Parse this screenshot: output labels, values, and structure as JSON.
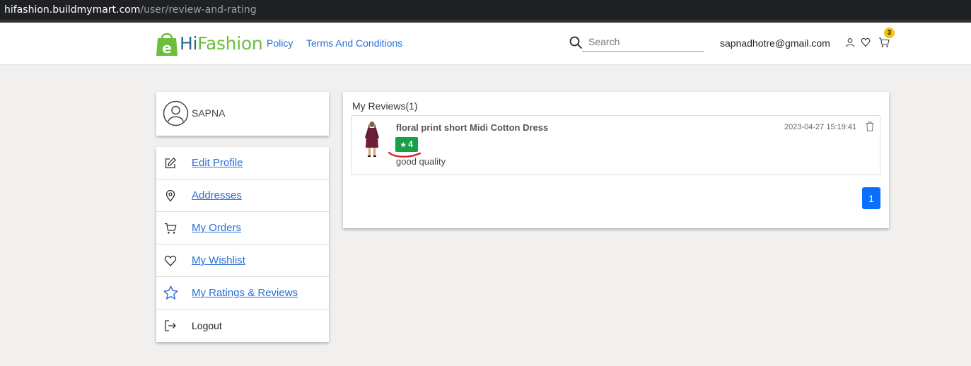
{
  "browser": {
    "url_domain": "hifashion.buildmymart.com",
    "url_path": "/user/review-and-rating"
  },
  "header": {
    "logo_hi": "Hi",
    "logo_fashion": "Fashion",
    "logo_letter": "e",
    "nav": [
      {
        "label": "Policy"
      },
      {
        "label": "Terms And Conditions"
      }
    ],
    "search": {
      "placeholder": "Search",
      "value": ""
    },
    "email": "sapnadhotre@gmail.com",
    "cart_count": "3",
    "icons": [
      "user-icon",
      "heart-icon",
      "cart-icon"
    ]
  },
  "sidebar": {
    "username": "SAPNA",
    "items": [
      {
        "label": "Edit Profile",
        "icon": "edit-icon"
      },
      {
        "label": "Addresses",
        "icon": "location-pin-icon"
      },
      {
        "label": "My Orders",
        "icon": "cart-icon"
      },
      {
        "label": "My Wishlist",
        "icon": "heart-icon"
      },
      {
        "label": "My Ratings & Reviews",
        "icon": "star-icon"
      },
      {
        "label": "Logout",
        "icon": "logout-icon"
      }
    ]
  },
  "reviews": {
    "title": "My Reviews(1)",
    "items": [
      {
        "product": "floral print short Midi Cotton Dress",
        "rating": "4",
        "rating_star": "★",
        "text": "good quality",
        "timestamp": "2023-04-27 15:19:41"
      }
    ],
    "pagination": {
      "current_page": "1"
    }
  },
  "colors": {
    "link": "#2a6fd6",
    "rating_badge": "#16a04a",
    "page_button": "#0d6efd",
    "logo_green": "#6cbf3a",
    "cart_badge": "#f4c20d"
  }
}
